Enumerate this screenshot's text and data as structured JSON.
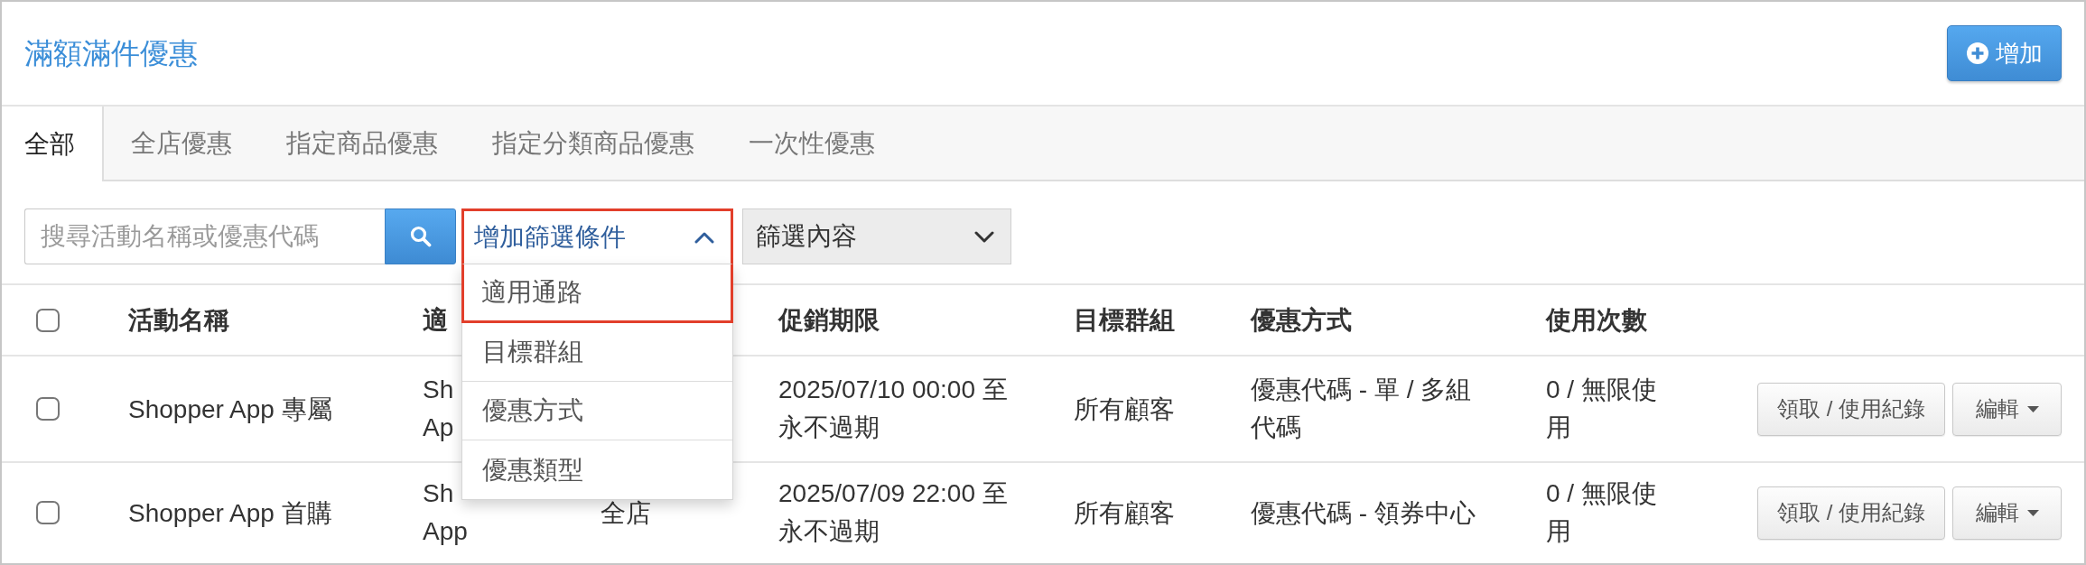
{
  "header": {
    "title": "滿額滿件優惠",
    "add_button": "增加"
  },
  "tabs": [
    {
      "label": "全部",
      "selected": true
    },
    {
      "label": "全店優惠",
      "selected": false
    },
    {
      "label": "指定商品優惠",
      "selected": false
    },
    {
      "label": "指定分類商品優惠",
      "selected": false
    },
    {
      "label": "一次性優惠",
      "selected": false
    }
  ],
  "filters": {
    "search": {
      "placeholder": "搜尋活動名稱或優惠代碼"
    },
    "condition_select": {
      "label": "增加篩選條件",
      "expanded": true,
      "highlighted": true,
      "options": [
        {
          "label": "適用通路",
          "highlighted": true
        },
        {
          "label": "目標群組",
          "highlighted": false
        },
        {
          "label": "優惠方式",
          "highlighted": false
        },
        {
          "label": "優惠類型",
          "highlighted": false
        }
      ]
    },
    "content_select": {
      "label": "篩選內容",
      "expanded": false,
      "disabled": true
    }
  },
  "table": {
    "header": {
      "checked": false,
      "campaign_name": "活動名稱",
      "column_2": "適",
      "period": "促銷期限",
      "target_group": "目標群組",
      "discount_method": "優惠方式",
      "usage_count": "使用次數"
    },
    "rows": [
      {
        "checked": false,
        "campaign_name": "Shopper App 專屬",
        "column_2": "Sh\nAp",
        "period": "2025/07/10 00:00 至永不過期",
        "target_group": "所有顧客",
        "discount_method": "優惠代碼 - 單 / 多組代碼",
        "usage_count": "0 / 無限使用",
        "record_button": "領取 / 使用紀錄",
        "edit_button": "編輯"
      },
      {
        "checked": false,
        "campaign_name": "Shopper App 首購",
        "column_2": "Sh\nApp",
        "column_3": "全店",
        "period": "2025/07/09 22:00 至永不過期",
        "target_group": "所有顧客",
        "discount_method": "優惠代碼 - 領券中心",
        "usage_count": "0 / 無限使用",
        "record_button": "領取 / 使用紀錄",
        "edit_button": "編輯"
      }
    ]
  }
}
